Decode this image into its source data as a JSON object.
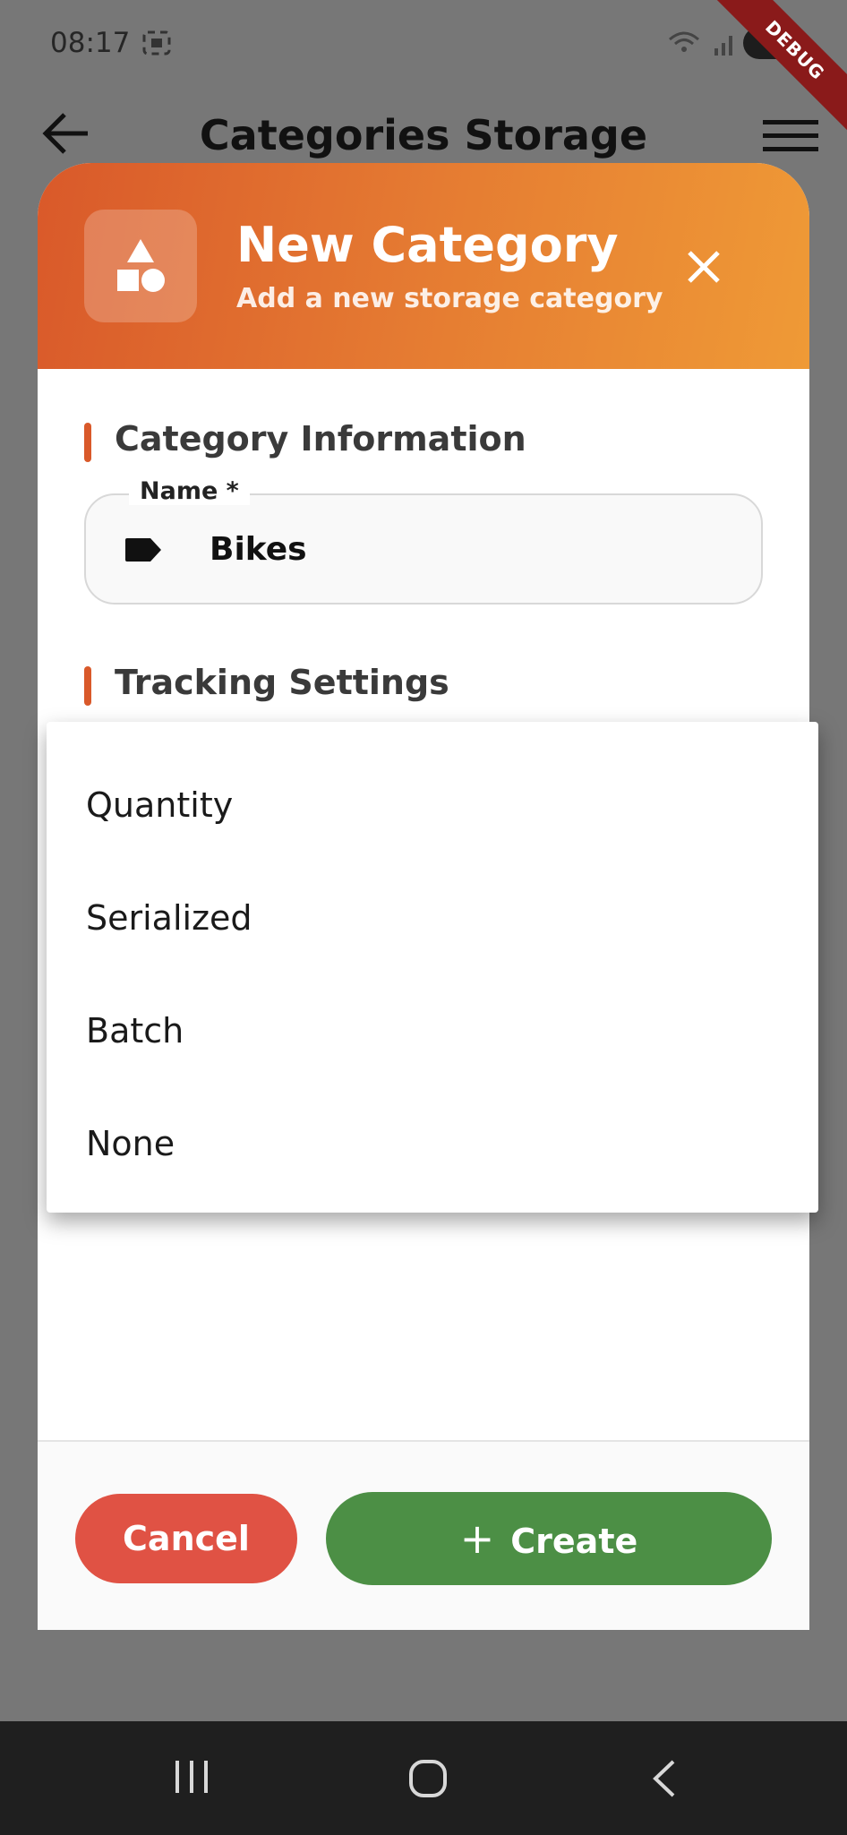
{
  "status_bar": {
    "time": "08:17",
    "debug_label": "DEBUG"
  },
  "app_bar": {
    "title": "Categories Storage"
  },
  "dialog": {
    "title": "New Category",
    "subtitle": "Add a new storage category",
    "sections": {
      "category_information": "Category Information",
      "tracking_settings": "Tracking Settings"
    },
    "name_field": {
      "label": "Name *",
      "value": "Bikes"
    },
    "buttons": {
      "cancel": "Cancel",
      "create": "Create"
    }
  },
  "dropdown": {
    "options": [
      "Quantity",
      "Serialized",
      "Batch",
      "None"
    ]
  },
  "colors": {
    "header_start": "#d9592a",
    "header_end": "#ef9a36",
    "cancel": "#e05244",
    "create": "#4c8f45",
    "accent": "#d9592a"
  }
}
